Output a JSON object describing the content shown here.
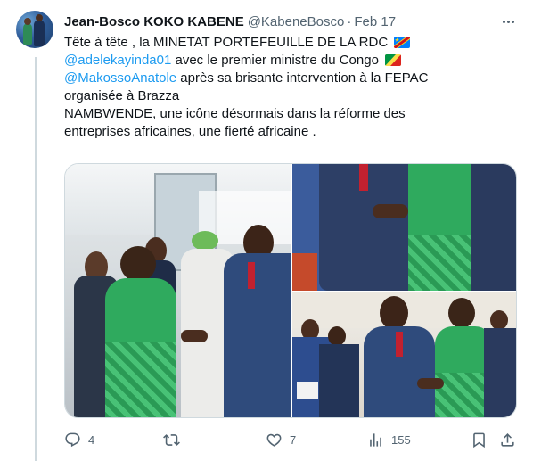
{
  "tweet": {
    "display_name": "Jean-Bosco KOKO KABENE",
    "handle": "@KabeneBosco",
    "separator": "·",
    "date": "Feb 17",
    "text": {
      "line1": "Tête à tête , la MINETAT PORTEFEUILLE DE LA RDC",
      "mention1": "@adelekayinda01",
      "line2_rest": " avec le premier ministre du Congo",
      "mention2": "@MakossoAnatole",
      "line3_rest": " après sa brisante intervention à la FEPAC",
      "line4": "organisée à Brazza",
      "line5": "NAMBWENDE, une icône désormais dans la réforme des",
      "line6": "entreprises africaines, une fierté africaine ."
    },
    "flags": [
      "flag-drc",
      "flag-congo-brazzaville"
    ]
  },
  "actions": {
    "reply": {
      "icon": "reply-icon",
      "count": "4"
    },
    "retweet": {
      "icon": "retweet-icon",
      "count": ""
    },
    "like": {
      "icon": "like-icon",
      "count": "7"
    },
    "views": {
      "icon": "views-icon",
      "count": "155"
    },
    "bookmark": {
      "icon": "bookmark-icon"
    },
    "share": {
      "icon": "share-icon"
    }
  },
  "colors": {
    "accent": "#1d9bf0",
    "secondary_text": "#536471",
    "primary_text": "#0f1419",
    "border": "#cfd9de"
  }
}
